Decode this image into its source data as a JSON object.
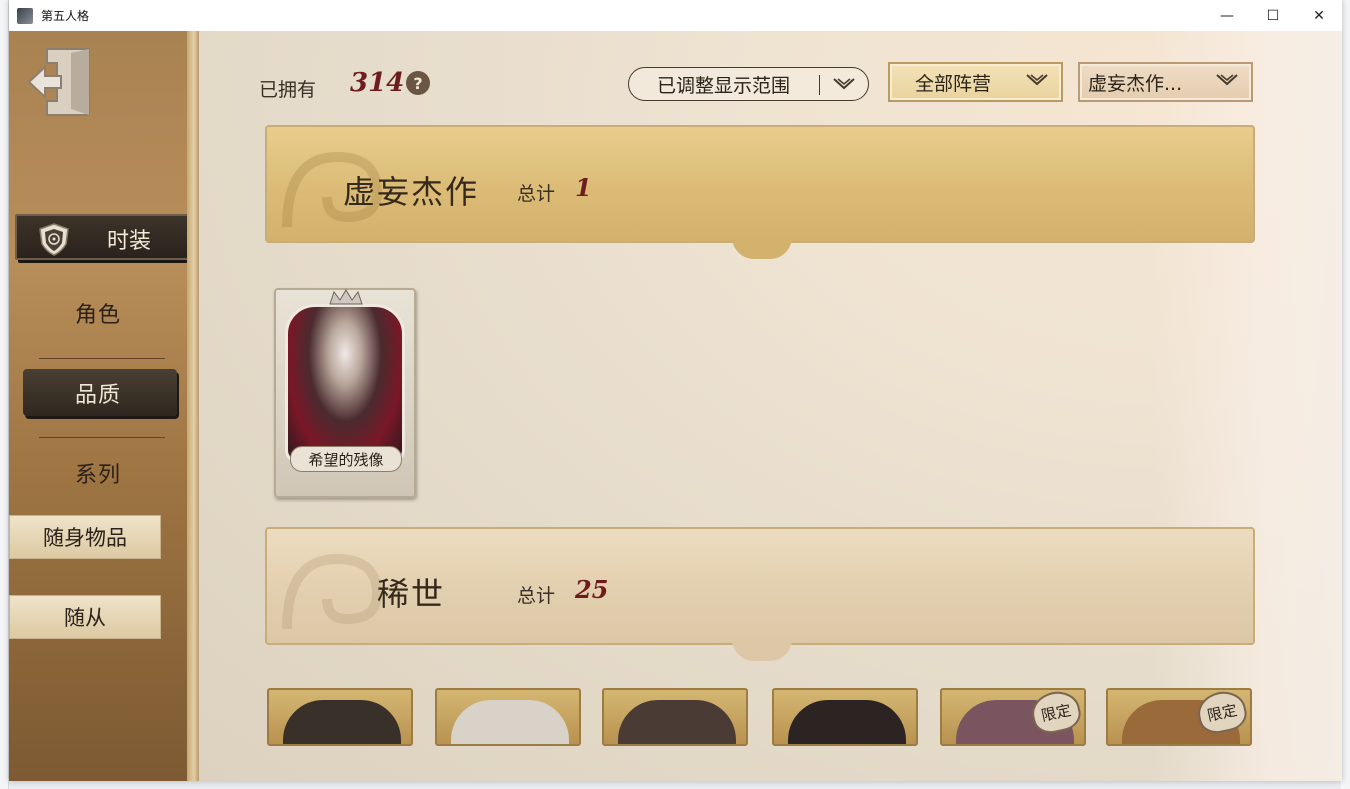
{
  "window": {
    "title": "第五人格",
    "controls": {
      "minimize": "—",
      "maximize": "☐",
      "close": "✕"
    }
  },
  "sidebar": {
    "active": "时装",
    "items": [
      {
        "label": "角色"
      },
      {
        "label": "品质"
      },
      {
        "label": "系列"
      },
      {
        "label": "随身物品"
      },
      {
        "label": "随从"
      }
    ]
  },
  "header": {
    "owned_label": "已拥有",
    "owned_count": "314",
    "help": "?",
    "filters": {
      "range": "已调整显示范围",
      "camp": "全部阵营",
      "quality": "虚妄杰作..."
    }
  },
  "sections": [
    {
      "title": "虚妄杰作",
      "total_label": "总计",
      "total": "1"
    },
    {
      "title": "稀世",
      "total_label": "总计",
      "total": "25"
    }
  ],
  "cards": {
    "featured": {
      "name": "希望的残像"
    },
    "rare_badges": [
      "限定",
      "限定"
    ]
  },
  "colors": {
    "accent_red": "#6d1d1d",
    "dark_panel": "#2f271f",
    "gold_banner": "#dbbb76"
  }
}
